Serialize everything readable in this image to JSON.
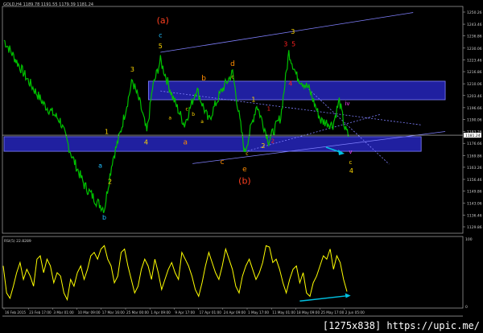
{
  "header": {
    "symbol": "GOLD,H4",
    "open": "1189.78",
    "high": "1191.55",
    "low": "1179.39",
    "close": "1181.24"
  },
  "watermark": "[1275x838] https://upic.me/",
  "colors": {
    "price": "#00c000",
    "rsi": "#ffff00",
    "zone": "#2020a0",
    "zone_border": "#8080ff",
    "trend": "#8080ff",
    "arrow": "#00c0e0",
    "bid_label_bg": "#ffffff"
  },
  "chart_data": [
    {
      "type": "line",
      "name": "GOLD,H4",
      "y_ticks": [
        "1250.26",
        "1243.46",
        "1236.86",
        "1230.06",
        "1223.46",
        "1216.86",
        "1210.06",
        "1203.46",
        "1196.66",
        "1190.06",
        "1183.26",
        "1176.66",
        "1169.86",
        "1163.26",
        "1156.46",
        "1149.86",
        "1143.06",
        "1136.46",
        "1129.86"
      ],
      "ylim": [
        1129.86,
        1250.26
      ],
      "current_price": "1181.24",
      "x_ticks": [
        "16 Feb 2015",
        "23 Feb 17:00",
        "3 Mar 01:00",
        "10 Mar 09:00",
        "17 Mar 16:00",
        "25 Mar 00:00",
        "1 Apr 09:00",
        "9 Apr 17:00",
        "17 Apr 01:00",
        "24 Apr 09:00",
        "1 May 17:00",
        "11 May 01:00",
        "18 May 09:00",
        "25 May 17:00",
        "2 Jun 05:00"
      ],
      "xlim_bars": [
        0,
        570
      ],
      "points": [
        [
          0,
          1234.5
        ],
        [
          15,
          1223.2
        ],
        [
          30,
          1211.9
        ],
        [
          50,
          1198.4
        ],
        [
          70,
          1189.4
        ],
        [
          85,
          1169.1
        ],
        [
          100,
          1153.3
        ],
        [
          115,
          1144.3
        ],
        [
          125,
          1139.8
        ],
        [
          135,
          1166.8
        ],
        [
          145,
          1182.6
        ],
        [
          160,
          1211.9
        ],
        [
          170,
          1198.4
        ],
        [
          178,
          1182.6
        ],
        [
          185,
          1207.4
        ],
        [
          195,
          1223.2
        ],
        [
          210,
          1202.9
        ],
        [
          225,
          1187.1
        ],
        [
          240,
          1207.4
        ],
        [
          255,
          1189.4
        ],
        [
          270,
          1205.2
        ],
        [
          285,
          1216.4
        ],
        [
          300,
          1171.3
        ],
        [
          315,
          1198.4
        ],
        [
          330,
          1178.1
        ],
        [
          345,
          1191.6
        ],
        [
          355,
          1227.7
        ],
        [
          365,
          1214.2
        ],
        [
          380,
          1207.4
        ],
        [
          395,
          1189.4
        ],
        [
          410,
          1187.1
        ],
        [
          418,
          1200.7
        ],
        [
          425,
          1184.9
        ],
        [
          430,
          1180.4
        ]
      ],
      "zones": [
        {
          "from_bar": 180,
          "to_bar": 550,
          "low": 1201.1,
          "high": 1211.5
        },
        {
          "from_bar": 0,
          "to_bar": 520,
          "low": 1172.2,
          "high": 1180.4
        }
      ],
      "trendlines": [
        {
          "from": [
            195,
            1227.7
          ],
          "to": [
            510,
            1250.0
          ],
          "color": "#8080ff",
          "dash": false
        },
        {
          "from": [
            235,
            1165.3
          ],
          "to": [
            550,
            1183.3
          ],
          "color": "#8080ff",
          "dash": false
        },
        {
          "from": [
            195,
            1206.0
          ],
          "to": [
            520,
            1187.0
          ],
          "color": "#8080ff",
          "dash": true
        },
        {
          "from": [
            300,
            1172.0
          ],
          "to": [
            470,
            1193.0
          ],
          "color": "#8080ff",
          "dash": true
        },
        {
          "from": [
            380,
            1207.0
          ],
          "to": [
            480,
            1165.0
          ],
          "color": "#8080ff",
          "dash": true
        }
      ],
      "wave_labels": [
        {
          "text": "(a)",
          "bar": 198,
          "price": 1244,
          "color": "#ff4020",
          "size": 11
        },
        {
          "text": "c",
          "bar": 195,
          "price": 1236,
          "color": "#20c0ff",
          "size": 8
        },
        {
          "text": "5",
          "bar": 195,
          "price": 1230,
          "color": "#ffd700",
          "size": 8
        },
        {
          "text": "3",
          "bar": 160,
          "price": 1217,
          "color": "#ffd700",
          "size": 8
        },
        {
          "text": "1",
          "bar": 128,
          "price": 1182,
          "color": "#ffd700",
          "size": 8
        },
        {
          "text": "a",
          "bar": 120,
          "price": 1163,
          "color": "#20c0ff",
          "size": 8
        },
        {
          "text": "2",
          "bar": 132,
          "price": 1154,
          "color": "#ffd700",
          "size": 8
        },
        {
          "text": "b",
          "bar": 125,
          "price": 1134,
          "color": "#20c0ff",
          "size": 8
        },
        {
          "text": "4",
          "bar": 177,
          "price": 1176,
          "color": "#ffd700",
          "size": 8
        },
        {
          "text": "a",
          "bar": 226,
          "price": 1176,
          "color": "#ff8c00",
          "size": 9
        },
        {
          "text": "b",
          "bar": 249,
          "price": 1212,
          "color": "#ff8c00",
          "size": 9
        },
        {
          "text": "c",
          "bar": 272,
          "price": 1165,
          "color": "#ff8c00",
          "size": 9
        },
        {
          "text": "d",
          "bar": 285,
          "price": 1220,
          "color": "#ff8c00",
          "size": 9
        },
        {
          "text": "e",
          "bar": 300,
          "price": 1161,
          "color": "#ff8c00",
          "size": 9
        },
        {
          "text": "(b)",
          "bar": 300,
          "price": 1154,
          "color": "#ff4020",
          "size": 11
        },
        {
          "text": "1",
          "bar": 311,
          "price": 1200,
          "color": "#ffd700",
          "size": 8
        },
        {
          "text": "2",
          "bar": 323,
          "price": 1174,
          "color": "#ffd700",
          "size": 8
        },
        {
          "text": "3",
          "bar": 360,
          "price": 1238,
          "color": "#ffd700",
          "size": 8
        },
        {
          "text": "3",
          "bar": 351,
          "price": 1231,
          "color": "#ff2020",
          "size": 8
        },
        {
          "text": "5",
          "bar": 361,
          "price": 1231,
          "color": "#ff2020",
          "size": 8
        },
        {
          "text": "4",
          "bar": 357,
          "price": 1209,
          "color": "#ff2020",
          "size": 8
        },
        {
          "text": "1",
          "bar": 330,
          "price": 1195,
          "color": "#ff2020",
          "size": 7
        },
        {
          "text": "2",
          "bar": 335,
          "price": 1177,
          "color": "#ff2020",
          "size": 7
        },
        {
          "text": "iv",
          "bar": 428,
          "price": 1198,
          "color": "#ff40ff",
          "size": 7
        },
        {
          "text": "v",
          "bar": 432,
          "price": 1171,
          "color": "#ff40ff",
          "size": 7
        },
        {
          "text": "c",
          "bar": 432,
          "price": 1165,
          "color": "#ffd700",
          "size": 7
        },
        {
          "text": "4",
          "bar": 433,
          "price": 1160,
          "color": "#ffd700",
          "size": 8
        },
        {
          "text": "a",
          "bar": 207,
          "price": 1190,
          "color": "#ffd700",
          "size": 6
        },
        {
          "text": "b",
          "bar": 236,
          "price": 1192,
          "color": "#ffd700",
          "size": 6
        },
        {
          "text": "c",
          "bar": 228,
          "price": 1195,
          "color": "#ffd700",
          "size": 6
        },
        {
          "text": "a",
          "bar": 247,
          "price": 1188,
          "color": "#ffd700",
          "size": 6
        },
        {
          "text": "c",
          "bar": 285,
          "price": 1213,
          "color": "#ffd700",
          "size": 6
        },
        {
          "text": "c",
          "bar": 303,
          "price": 1170,
          "color": "#ffd700",
          "size": 6
        }
      ]
    },
    {
      "type": "line",
      "name": "RSI(5) 22.8289",
      "ylim": [
        0,
        100
      ],
      "y_ticks": [
        "100",
        "0"
      ],
      "values": [
        60,
        20,
        12,
        30,
        50,
        65,
        40,
        55,
        45,
        30,
        70,
        75,
        50,
        70,
        60,
        35,
        50,
        45,
        20,
        10,
        40,
        30,
        50,
        60,
        40,
        55,
        75,
        80,
        70,
        85,
        90,
        70,
        60,
        35,
        45,
        80,
        85,
        60,
        40,
        20,
        30,
        55,
        70,
        60,
        40,
        70,
        50,
        25,
        40,
        55,
        65,
        50,
        40,
        80,
        70,
        60,
        45,
        25,
        15,
        35,
        60,
        80,
        65,
        50,
        40,
        60,
        85,
        70,
        55,
        30,
        20,
        45,
        60,
        70,
        55,
        40,
        50,
        65,
        90,
        88,
        65,
        70,
        55,
        35,
        20,
        40,
        55,
        60,
        35,
        50,
        20,
        15,
        35,
        45,
        60,
        75,
        70,
        85,
        55,
        75,
        65,
        40,
        22
      ],
      "arrow": {
        "from": [
          88,
          8
        ],
        "to": [
          100,
          16
        ]
      }
    }
  ]
}
